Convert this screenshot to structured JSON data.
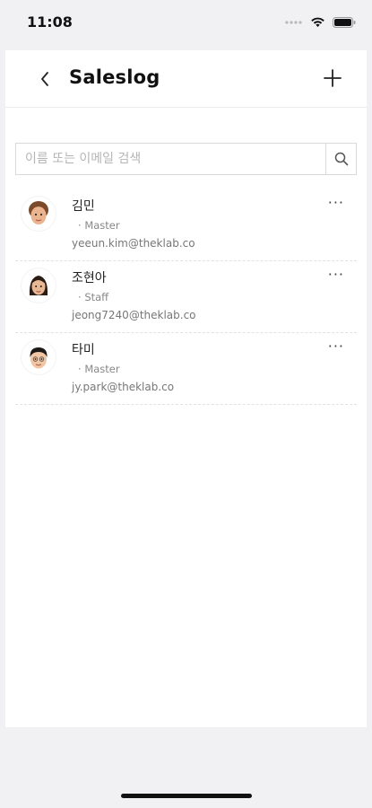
{
  "status_bar": {
    "time": "11:08"
  },
  "header": {
    "title": "Saleslog"
  },
  "search": {
    "placeholder": "이름 또는 이메일 검색"
  },
  "members": [
    {
      "name": "김민",
      "role": "Master",
      "email": "yeeun.kim@theklab.co",
      "avatar": "female-memoji-avatar-1"
    },
    {
      "name": "조현아",
      "role": "Staff",
      "email": "jeong7240@theklab.co",
      "avatar": "female-memoji-avatar-2"
    },
    {
      "name": "타미",
      "role": "Master",
      "email": "jy.park@theklab.co",
      "avatar": "male-memoji-avatar"
    }
  ],
  "role_prefix": "·",
  "more_label": "···",
  "colors": {
    "background": "#f1f1f3",
    "card": "#ffffff",
    "border": "#d9d9d9",
    "muted_text": "#888888"
  }
}
